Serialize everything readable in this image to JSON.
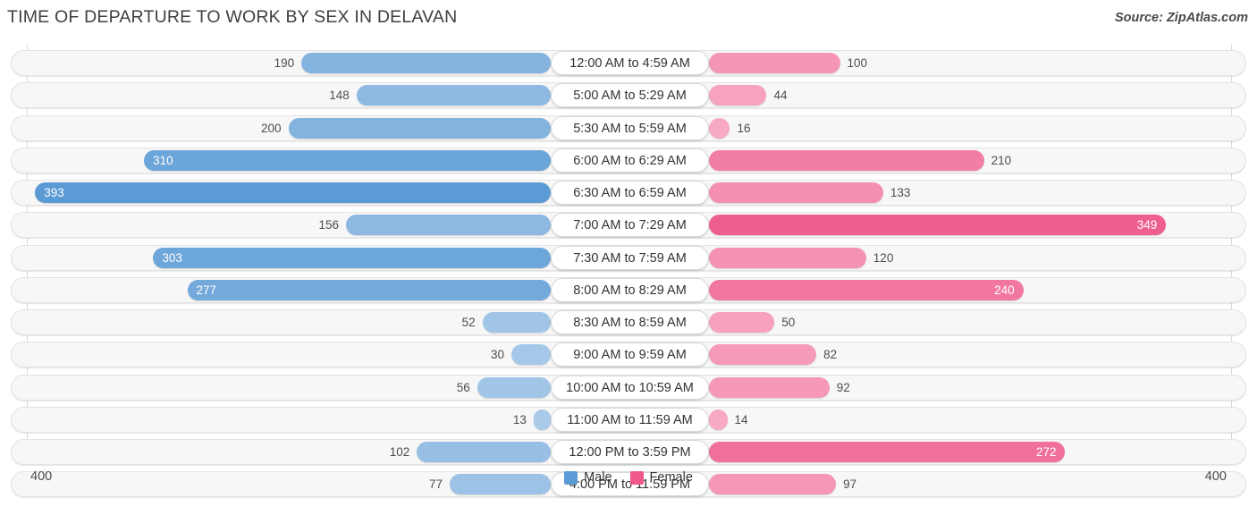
{
  "header": {
    "title": "TIME OF DEPARTURE TO WORK BY SEX IN DELAVAN",
    "source": "Source: ZipAtlas.com"
  },
  "axis": {
    "left_label": "400",
    "right_label": "400",
    "max": 400
  },
  "legend": [
    {
      "label": "Male",
      "color": "#5b9bd5"
    },
    {
      "label": "Female",
      "color": "#f0588c"
    }
  ],
  "colors": {
    "male_dark": "#5b9bd5",
    "male_light": "#a9cae9",
    "female_dark": "#ef5f8d",
    "female_light": "#f8a9c5",
    "track": "#f7f7f7",
    "track_border": "#e3e3e3",
    "grid": "#d9d9d9"
  },
  "chart_data": {
    "type": "bar",
    "orientation": "horizontal-diverging",
    "title": "TIME OF DEPARTURE TO WORK BY SEX IN DELAVAN",
    "xlabel": "",
    "ylabel": "",
    "xlim": [
      400,
      400
    ],
    "grid": true,
    "legend_position": "bottom-center",
    "categories": [
      "12:00 AM to 4:59 AM",
      "5:00 AM to 5:29 AM",
      "5:30 AM to 5:59 AM",
      "6:00 AM to 6:29 AM",
      "6:30 AM to 6:59 AM",
      "7:00 AM to 7:29 AM",
      "7:30 AM to 7:59 AM",
      "8:00 AM to 8:29 AM",
      "8:30 AM to 8:59 AM",
      "9:00 AM to 9:59 AM",
      "10:00 AM to 10:59 AM",
      "11:00 AM to 11:59 AM",
      "12:00 PM to 3:59 PM",
      "4:00 PM to 11:59 PM"
    ],
    "series": [
      {
        "name": "Male",
        "color": "#5b9bd5",
        "values": [
          190,
          148,
          200,
          310,
          393,
          156,
          303,
          277,
          52,
          30,
          56,
          13,
          102,
          77
        ]
      },
      {
        "name": "Female",
        "color": "#ef5f8d",
        "values": [
          100,
          44,
          16,
          210,
          133,
          349,
          120,
          240,
          50,
          82,
          92,
          14,
          272,
          97
        ]
      }
    ]
  },
  "rows": [
    {
      "label": "12:00 AM to 4:59 AM",
      "male": 190,
      "male_text": "190",
      "female": 100,
      "female_text": "100"
    },
    {
      "label": "5:00 AM to 5:29 AM",
      "male": 148,
      "male_text": "148",
      "female": 44,
      "female_text": "44"
    },
    {
      "label": "5:30 AM to 5:59 AM",
      "male": 200,
      "male_text": "200",
      "female": 16,
      "female_text": "16"
    },
    {
      "label": "6:00 AM to 6:29 AM",
      "male": 310,
      "male_text": "310",
      "female": 210,
      "female_text": "210"
    },
    {
      "label": "6:30 AM to 6:59 AM",
      "male": 393,
      "male_text": "393",
      "female": 133,
      "female_text": "133"
    },
    {
      "label": "7:00 AM to 7:29 AM",
      "male": 156,
      "male_text": "156",
      "female": 349,
      "female_text": "349"
    },
    {
      "label": "7:30 AM to 7:59 AM",
      "male": 303,
      "male_text": "303",
      "female": 120,
      "female_text": "120"
    },
    {
      "label": "8:00 AM to 8:29 AM",
      "male": 277,
      "male_text": "277",
      "female": 240,
      "female_text": "240"
    },
    {
      "label": "8:30 AM to 8:59 AM",
      "male": 52,
      "male_text": "52",
      "female": 50,
      "female_text": "50"
    },
    {
      "label": "9:00 AM to 9:59 AM",
      "male": 30,
      "male_text": "30",
      "female": 82,
      "female_text": "82"
    },
    {
      "label": "10:00 AM to 10:59 AM",
      "male": 56,
      "male_text": "56",
      "female": 92,
      "female_text": "92"
    },
    {
      "label": "11:00 AM to 11:59 AM",
      "male": 13,
      "male_text": "13",
      "female": 14,
      "female_text": "14"
    },
    {
      "label": "12:00 PM to 3:59 PM",
      "male": 102,
      "male_text": "102",
      "female": 272,
      "female_text": "272"
    },
    {
      "label": "4:00 PM to 11:59 PM",
      "male": 77,
      "male_text": "77",
      "female": 97,
      "female_text": "97"
    }
  ]
}
